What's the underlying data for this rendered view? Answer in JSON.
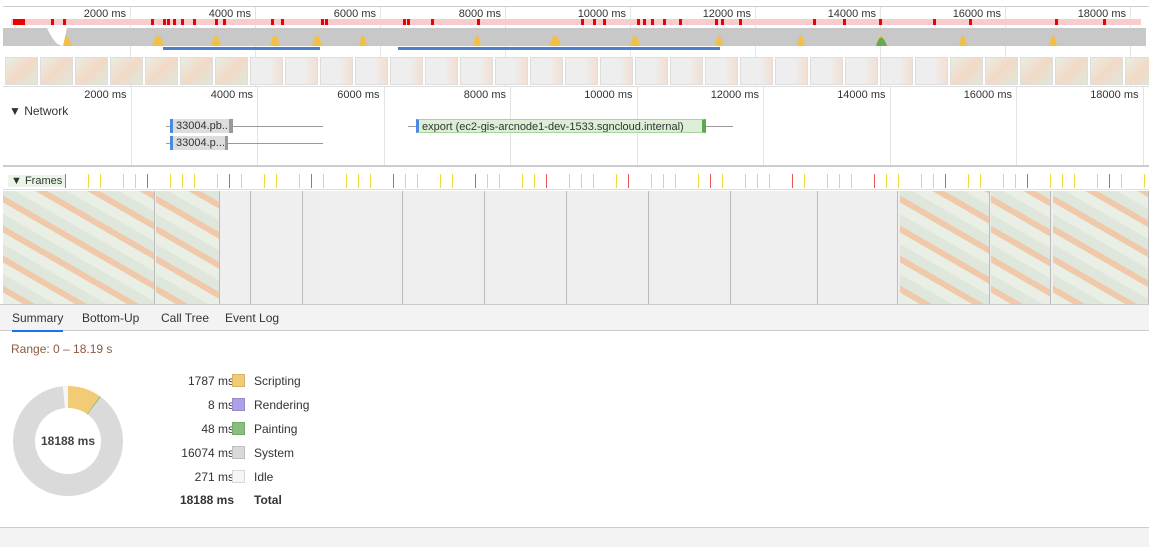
{
  "overview": {
    "ticks": [
      "2000 ms",
      "4000 ms",
      "6000 ms",
      "8000 ms",
      "10000 ms",
      "12000 ms",
      "14000 ms",
      "16000 ms",
      "18000 ms"
    ]
  },
  "network": {
    "label": "Network",
    "ticks": [
      "2000 ms",
      "4000 ms",
      "6000 ms",
      "8000 ms",
      "10000 ms",
      "12000 ms",
      "14000 ms",
      "16000 ms",
      "18000 ms"
    ],
    "requests": [
      {
        "label": "33004.pb..."
      },
      {
        "label": "33004.p..."
      },
      {
        "label": "export (ec2-gis-arcnode1-dev-1533.sgncloud.internal)"
      }
    ]
  },
  "frames": {
    "label": "Frames"
  },
  "tabs": [
    "Summary",
    "Bottom-Up",
    "Call Tree",
    "Event Log"
  ],
  "summary": {
    "range": "Range: 0 – 18.19 s",
    "total_center": "18188 ms",
    "items": [
      {
        "value": "1787 ms",
        "label": "Scripting",
        "color": "#f2cb76",
        "ms": 1787
      },
      {
        "value": "8 ms",
        "label": "Rendering",
        "color": "#af9ee8",
        "ms": 8
      },
      {
        "value": "48 ms",
        "label": "Painting",
        "color": "#89bf7e",
        "ms": 48
      },
      {
        "value": "16074 ms",
        "label": "System",
        "color": "#dadada",
        "ms": 16074
      },
      {
        "value": "271 ms",
        "label": "Idle",
        "color": "#f6f6f6",
        "ms": 271
      }
    ],
    "total_value": "18188 ms",
    "total_label": "Total"
  }
}
